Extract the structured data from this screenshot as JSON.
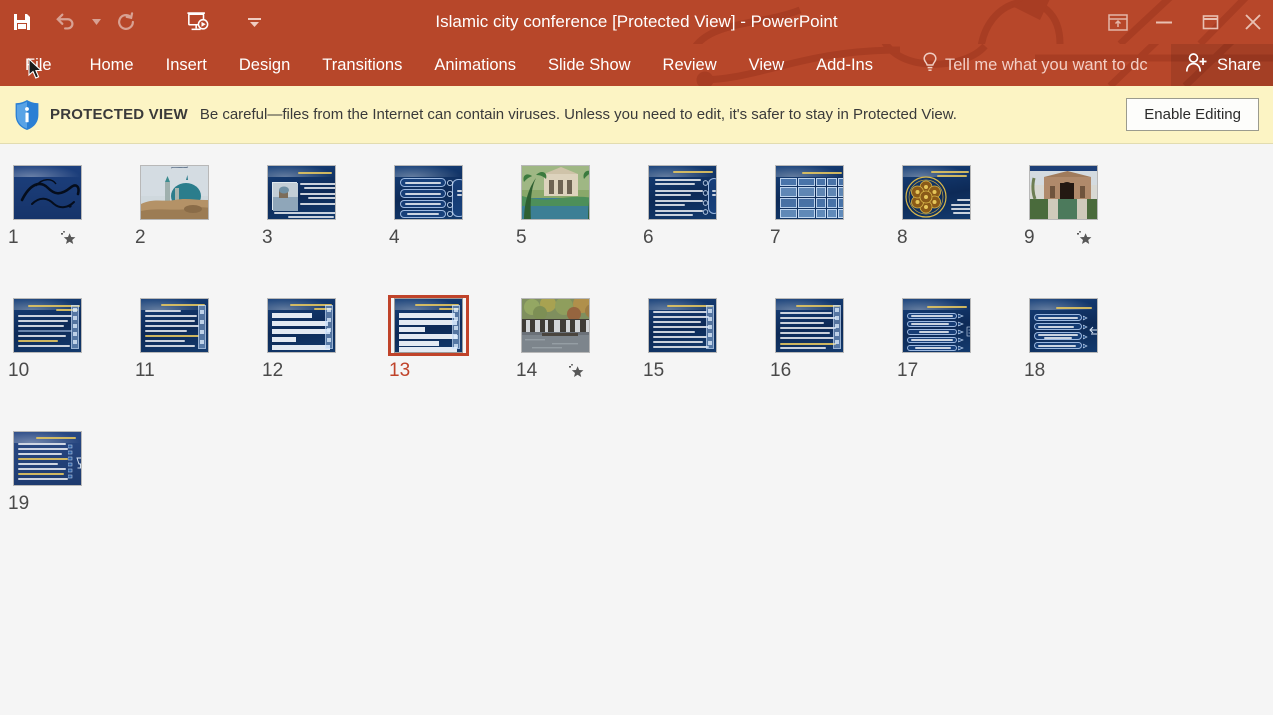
{
  "window": {
    "title": "Islamic city conference [Protected View] - PowerPoint",
    "accent_color": "#b7472a",
    "canvas_color": "#f5f5f5"
  },
  "quick_access": [
    {
      "name": "save-icon",
      "label": "Save",
      "enabled": true
    },
    {
      "name": "undo-icon",
      "label": "Undo",
      "enabled": false
    },
    {
      "name": "undo-dropdown-icon",
      "label": "Undo options",
      "enabled": false
    },
    {
      "name": "redo-icon",
      "label": "Redo",
      "enabled": false
    },
    {
      "name": "start-slideshow-icon",
      "label": "Start From Beginning",
      "enabled": true
    },
    {
      "name": "customize-quick-access-icon",
      "label": "Customize Quick Access Toolbar",
      "enabled": true
    }
  ],
  "window_controls": [
    {
      "name": "ribbon-display-options-icon",
      "label": "Ribbon Display Options"
    },
    {
      "name": "minimize-icon",
      "label": "Minimize"
    },
    {
      "name": "restore-icon",
      "label": "Restore Down"
    },
    {
      "name": "close-icon",
      "label": "Close"
    }
  ],
  "ribbon": {
    "tabs": [
      {
        "label": "File",
        "active": false
      },
      {
        "label": "Home",
        "active": false
      },
      {
        "label": "Insert",
        "active": false
      },
      {
        "label": "Design",
        "active": false
      },
      {
        "label": "Transitions",
        "active": false
      },
      {
        "label": "Animations",
        "active": false
      },
      {
        "label": "Slide Show",
        "active": false
      },
      {
        "label": "Review",
        "active": false
      },
      {
        "label": "View",
        "active": false
      },
      {
        "label": "Add-Ins",
        "active": false
      }
    ],
    "tell_me": "Tell me what you want to dc",
    "share": "Share"
  },
  "protected_view": {
    "badge": "PROTECTED VIEW",
    "message": "Be careful—files from the Internet can contain viruses. Unless you need to edit, it's safer to stay in Protected View.",
    "button": "Enable Editing",
    "bar_color": "#fcf4c4",
    "shield_color": "#2a7fd4"
  },
  "slide_sorter": {
    "selected_slide": 13,
    "rows": [
      [
        {
          "number": "1",
          "kind": "calligraphy",
          "animated": true
        },
        {
          "number": "2",
          "kind": "photo-mosque",
          "animated": false
        },
        {
          "number": "3",
          "kind": "image-text",
          "animated": false
        },
        {
          "number": "4",
          "kind": "diagram",
          "animated": false
        },
        {
          "number": "5",
          "kind": "photo-villa",
          "animated": false
        },
        {
          "number": "6",
          "kind": "diagram-text",
          "animated": false
        },
        {
          "number": "7",
          "kind": "table",
          "animated": false
        },
        {
          "number": "8",
          "kind": "pattern-circle",
          "animated": false
        },
        {
          "number": "9",
          "kind": "photo-garden",
          "animated": true
        }
      ],
      [
        {
          "number": "10",
          "kind": "text-list",
          "animated": false
        },
        {
          "number": "11",
          "kind": "text-dense",
          "animated": false
        },
        {
          "number": "12",
          "kind": "text-bars",
          "animated": false
        },
        {
          "number": "13",
          "kind": "text-bars",
          "animated": false,
          "selected": true
        },
        {
          "number": "14",
          "kind": "photo-waterfall",
          "animated": true
        },
        {
          "number": "15",
          "kind": "text-list",
          "animated": false
        },
        {
          "number": "16",
          "kind": "text-list",
          "animated": false
        },
        {
          "number": "17",
          "kind": "text-bullets",
          "animated": false
        },
        {
          "number": "18",
          "kind": "text-arrows",
          "animated": false
        }
      ],
      [
        {
          "number": "19",
          "kind": "text-list-icon",
          "animated": false
        }
      ]
    ]
  }
}
